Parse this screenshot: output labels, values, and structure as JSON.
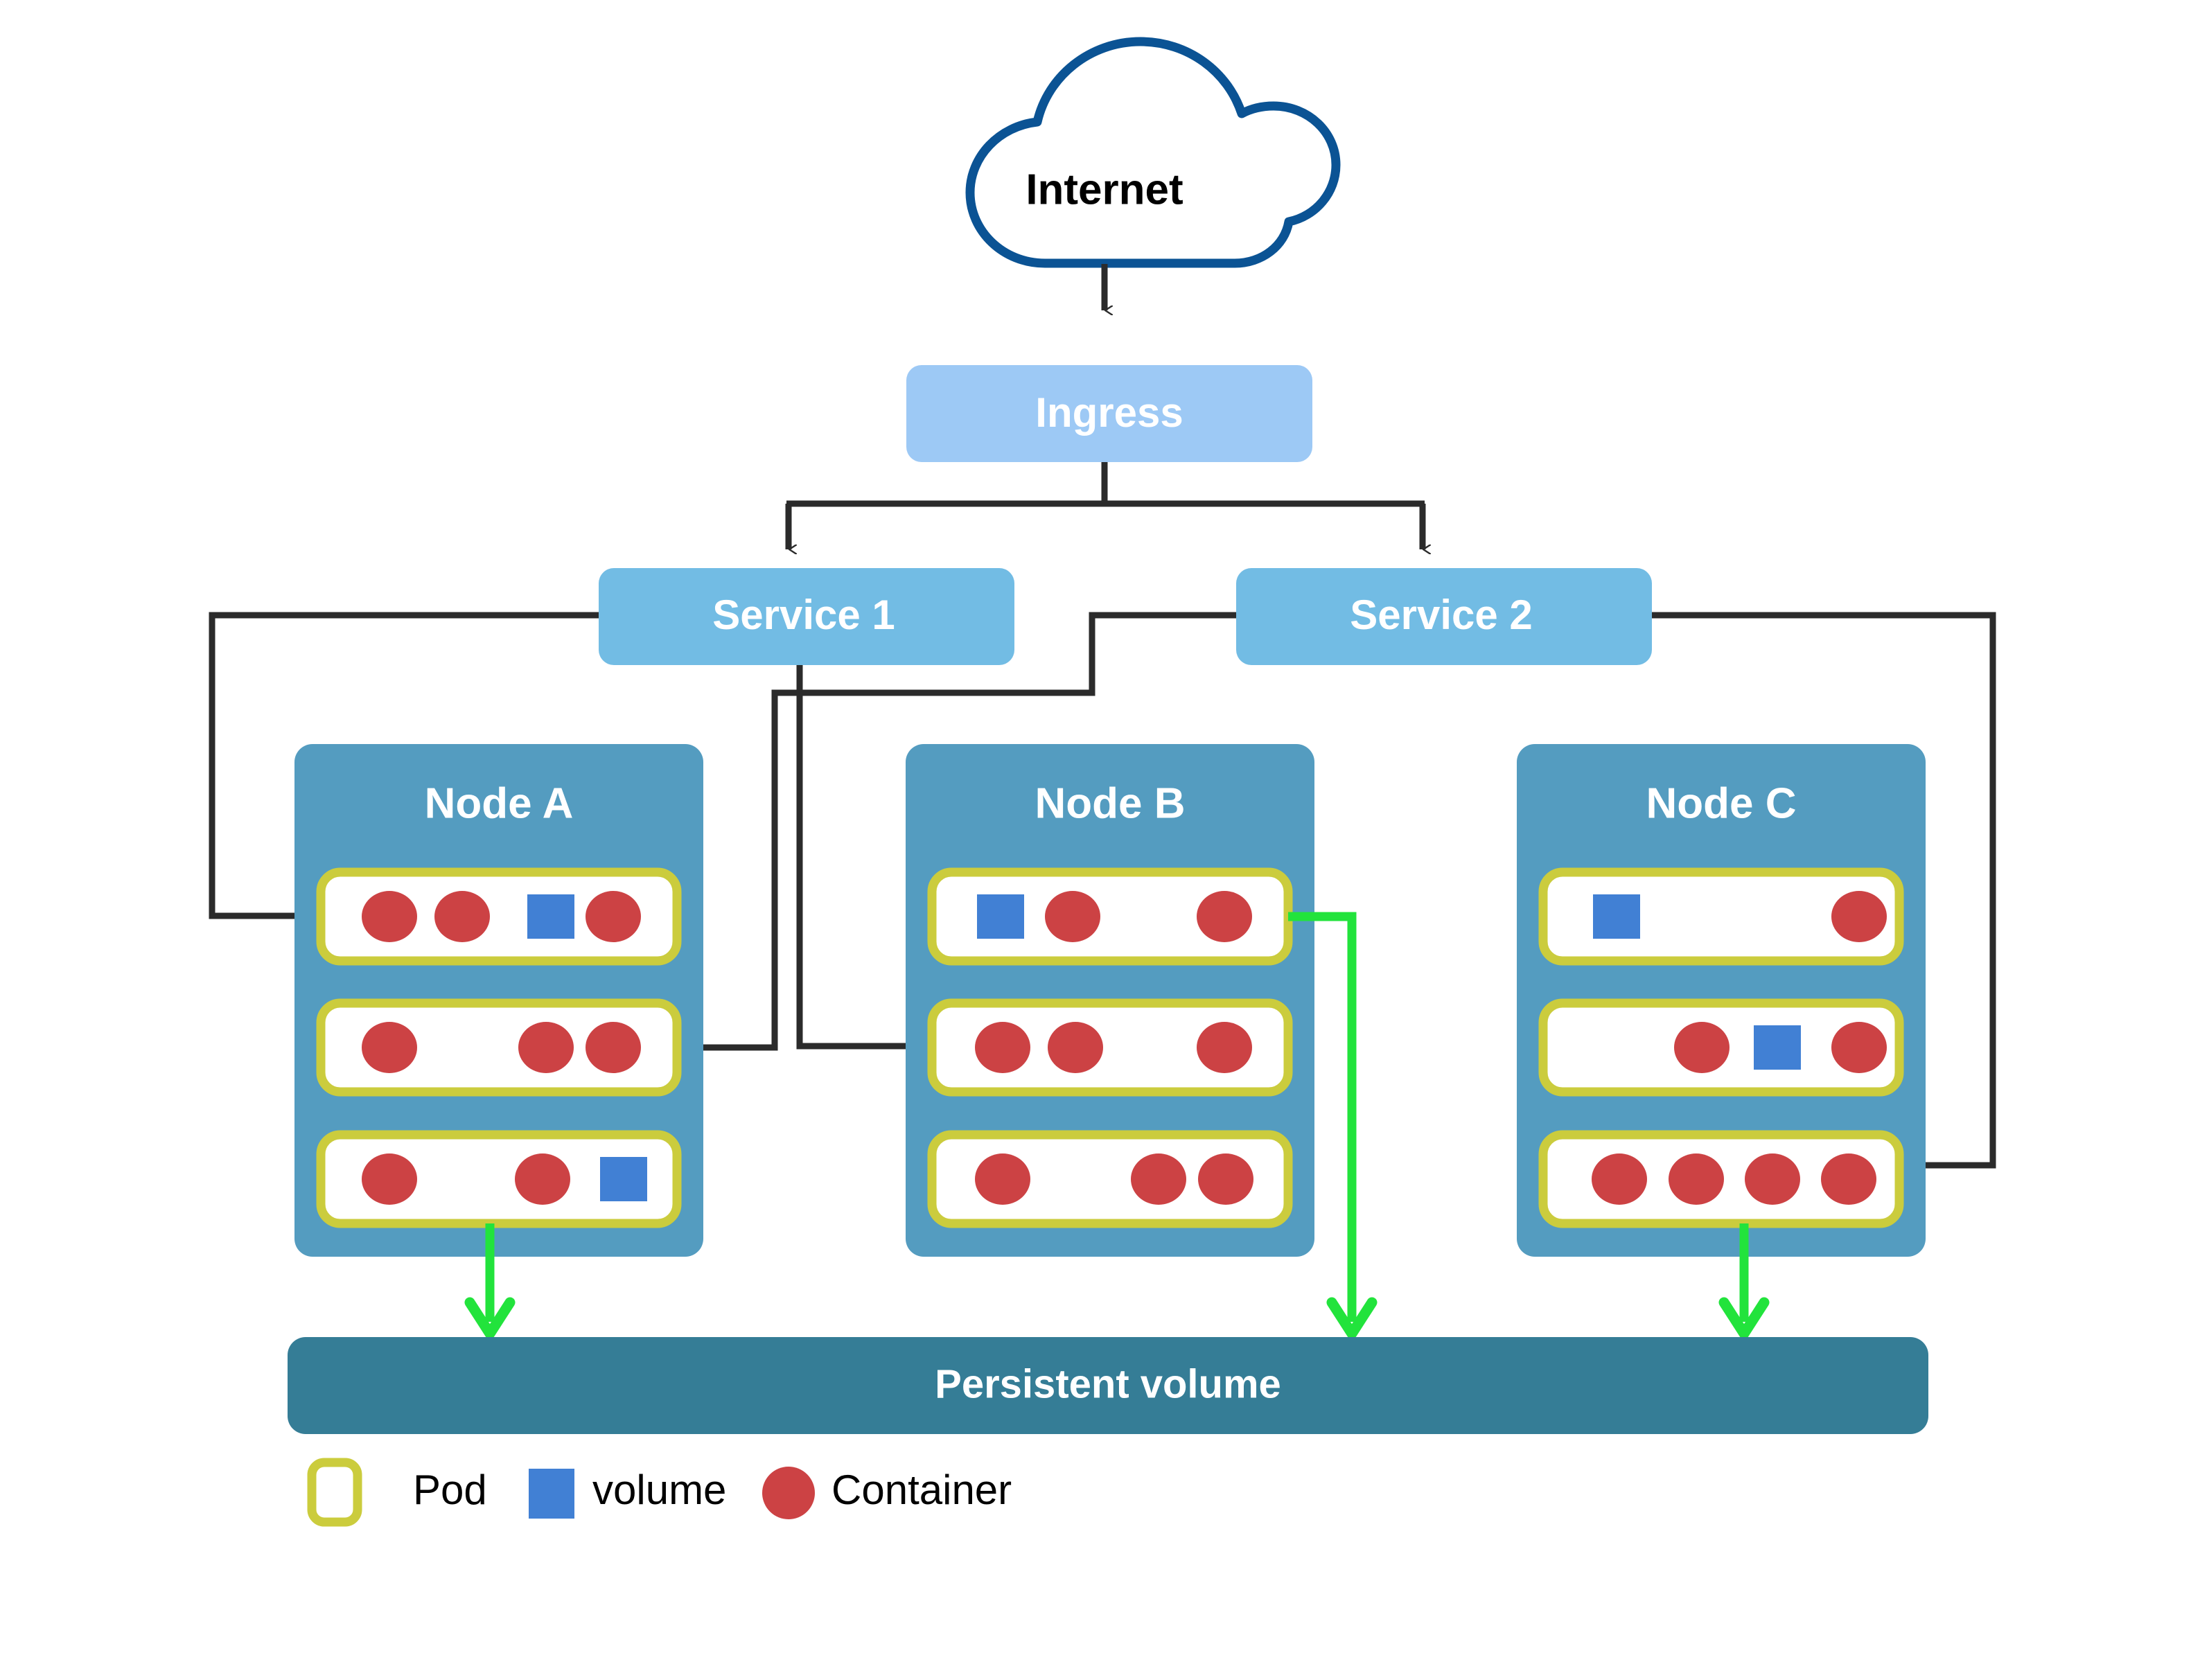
{
  "diagram": {
    "title_visible": false,
    "colors": {
      "cloud_stroke": "#0B5394",
      "ingress_fill": "#9DC9F5",
      "service_fill": "#72BCE4",
      "node_fill": "#549CC0",
      "pod_border": "#CBCC3D",
      "pod_fill": "#FFFFFF",
      "container_red": "#CC4244",
      "volume_blue": "#4180D4",
      "persistent_volume_fill": "#357D96",
      "connector_black": "#2B2B2B",
      "connector_green": "#22E33C",
      "text_white": "#FFFFFF",
      "text_black": "#000000"
    }
  },
  "cloud": {
    "label": "Internet"
  },
  "ingress": {
    "label": "Ingress"
  },
  "services": [
    {
      "label": "Service 1"
    },
    {
      "label": "Service 2"
    }
  ],
  "nodes": [
    {
      "title": "Node A",
      "pods": [
        {
          "slots": [
            "container",
            "container",
            "volume",
            "container"
          ]
        },
        {
          "slots": [
            "container",
            "empty",
            "container",
            "container"
          ]
        },
        {
          "slots": [
            "container",
            "empty",
            "container",
            "volume"
          ]
        }
      ]
    },
    {
      "title": "Node B",
      "pods": [
        {
          "slots": [
            "volume",
            "container",
            "empty",
            "container"
          ]
        },
        {
          "slots": [
            "container",
            "container",
            "empty",
            "container"
          ]
        },
        {
          "slots": [
            "container",
            "empty",
            "container",
            "container"
          ]
        }
      ]
    },
    {
      "title": "Node C",
      "pods": [
        {
          "slots": [
            "volume",
            "empty",
            "empty",
            "container"
          ]
        },
        {
          "slots": [
            "empty",
            "container",
            "volume",
            "container"
          ]
        },
        {
          "slots": [
            "container",
            "container",
            "container",
            "container"
          ]
        }
      ]
    }
  ],
  "persistent_volume": {
    "label": "Persistent volume"
  },
  "legend": {
    "items": [
      {
        "label": "Pod",
        "symbol": "pod-outline"
      },
      {
        "label": "volume",
        "symbol": "volume-square"
      },
      {
        "label": "Container",
        "symbol": "container-circle"
      }
    ]
  },
  "connections": {
    "internet_to_ingress": "arrow-down",
    "ingress_to_service1": "arrow-down",
    "ingress_to_service2": "arrow-down",
    "service1_to_nodeA_pod1": "arrow-right",
    "service1_to_nodeB_pod2": "arrow-right",
    "service2_to_nodeA_pod2": "arrow-left",
    "service2_to_nodeC_pod3": "arrow-left",
    "nodeA_to_persistent_volume": "green-arrow-down",
    "nodeB_to_persistent_volume": "green-arrow-down",
    "nodeC_to_persistent_volume": "green-arrow-down"
  }
}
